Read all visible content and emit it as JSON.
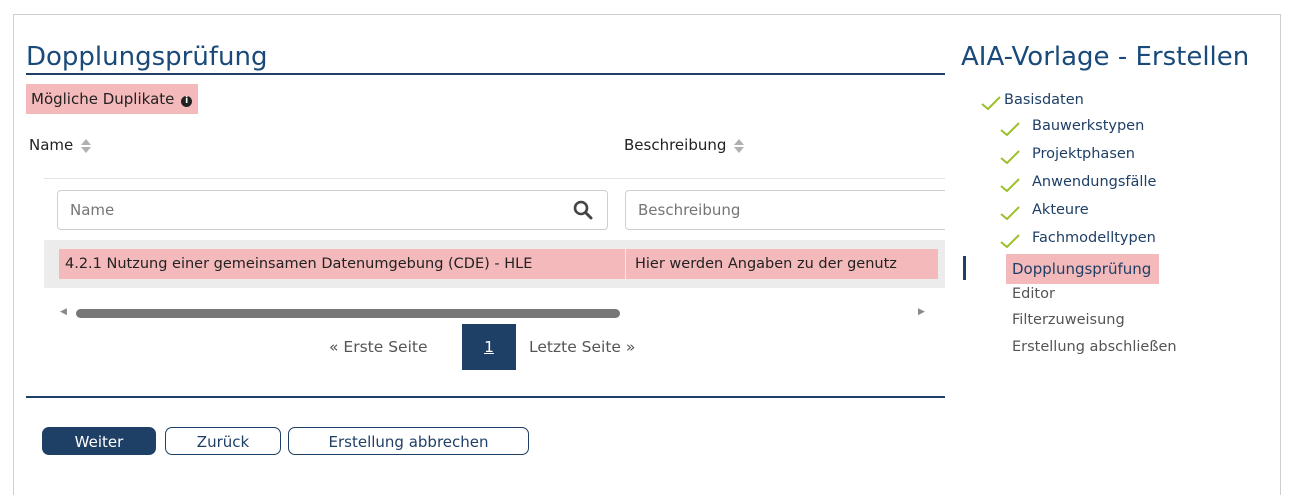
{
  "main": {
    "title": "Dopplungsprüfung",
    "duplicates_label": "Mögliche Duplikate",
    "columns": [
      {
        "label": "Name",
        "filter_placeholder": "Name"
      },
      {
        "label": "Beschreibung",
        "filter_placeholder": "Beschreibung"
      }
    ],
    "rows": [
      {
        "name": "4.2.1 Nutzung einer gemeinsamen Datenumgebung (CDE) - HLE",
        "description": "Hier werden Angaben zu der genutz"
      }
    ],
    "pager": {
      "first": "« Erste Seite",
      "current": "1",
      "last": "Letzte Seite »"
    },
    "buttons": {
      "next": "Weiter",
      "back": "Zurück",
      "cancel": "Erstellung abbrechen"
    }
  },
  "sidebar": {
    "title": "AIA-Vorlage - Erstellen",
    "steps": [
      {
        "label": "Basisdaten",
        "done": true
      },
      {
        "label": "Bauwerkstypen",
        "done": true
      },
      {
        "label": "Projektphasen",
        "done": true
      },
      {
        "label": "Anwendungsfälle",
        "done": true
      },
      {
        "label": "Akteure",
        "done": true
      },
      {
        "label": "Fachmodelltypen",
        "done": true
      },
      {
        "label": "Dopplungsprüfung",
        "done": false,
        "active": true
      },
      {
        "label": "Editor",
        "done": false
      },
      {
        "label": "Filterzuweisung",
        "done": false
      },
      {
        "label": "Erstellung abschließen",
        "done": false
      }
    ]
  },
  "colors": {
    "primary": "#1e3f66",
    "highlight": "#f4b9bb",
    "check": "#9bbf2a"
  }
}
